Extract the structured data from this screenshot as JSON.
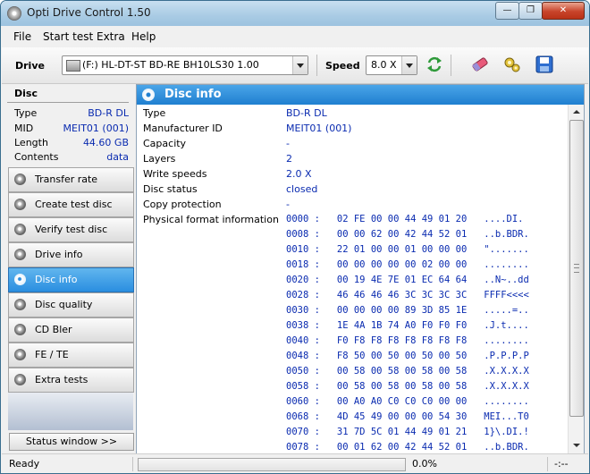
{
  "window": {
    "title": "Opti Drive Control 1.50",
    "minimize_glyph": "—",
    "maximize_glyph": "❐",
    "close_glyph": "✕"
  },
  "menu": [
    "File",
    "Start test",
    "Extra",
    "Help"
  ],
  "toolbar": {
    "drive_label": "Drive",
    "drive_value": "(F:)   HL-DT-ST BD-RE  BH10LS30 1.00",
    "speed_label": "Speed",
    "speed_value": "8.0 X",
    "icons": [
      "refresh-icon",
      "eraser-icon",
      "settings-icon",
      "save-icon"
    ]
  },
  "disc": {
    "heading": "Disc",
    "props": [
      {
        "key": "Type",
        "value": "BD-R DL"
      },
      {
        "key": "MID",
        "value": "MEIT01 (001)"
      },
      {
        "key": "Length",
        "value": "44.60 GB"
      },
      {
        "key": "Contents",
        "value": "data"
      }
    ]
  },
  "nav": [
    {
      "label": "Transfer rate",
      "active": false
    },
    {
      "label": "Create test disc",
      "active": false
    },
    {
      "label": "Verify test disc",
      "active": false
    },
    {
      "label": "Drive info",
      "active": false
    },
    {
      "label": "Disc info",
      "active": true
    },
    {
      "label": "Disc quality",
      "active": false
    },
    {
      "label": "CD Bler",
      "active": false
    },
    {
      "label": "FE / TE",
      "active": false
    },
    {
      "label": "Extra tests",
      "active": false
    }
  ],
  "status_window_label": "Status window >>",
  "main": {
    "title": "Disc info",
    "rows": [
      {
        "key": "Type",
        "value": "BD-R DL"
      },
      {
        "key": "Manufacturer ID",
        "value": "MEIT01 (001)"
      },
      {
        "key": "Capacity",
        "value": "-"
      },
      {
        "key": "Layers",
        "value": "2"
      },
      {
        "key": "Write speeds",
        "value": "2.0 X"
      },
      {
        "key": "Disc status",
        "value": "closed"
      },
      {
        "key": "Copy protection",
        "value": "-"
      },
      {
        "key": "Physical format information",
        "value": ""
      }
    ],
    "hex_lines": [
      "0000 :   02 FE 00 00 44 49 01 20   ....DI.",
      "0008 :   00 00 62 00 42 44 52 01   ..b.BDR.",
      "0010 :   22 01 00 00 01 00 00 00   \".......",
      "0018 :   00 00 00 00 00 02 00 00   ........",
      "0020 :   00 19 4E 7E 01 EC 64 64   ..N~..dd",
      "0028 :   46 46 46 46 3C 3C 3C 3C   FFFF<<<<",
      "0030 :   00 00 00 00 89 3D 85 1E   .....=..",
      "0038 :   1E 4A 1B 74 A0 F0 F0 F0   .J.t....",
      "0040 :   F0 F8 F8 F8 F8 F8 F8 F8   ........",
      "0048 :   F8 50 00 50 00 50 00 50   .P.P.P.P",
      "0050 :   00 58 00 58 00 58 00 58   .X.X.X.X",
      "0058 :   00 58 00 58 00 58 00 58   .X.X.X.X",
      "0060 :   00 A0 A0 C0 C0 C0 00 00   ........",
      "0068 :   4D 45 49 00 00 00 54 30   MEI...T0",
      "0070 :   31 7D 5C 01 44 49 01 21   1}\\.DI.!",
      "0078 :   00 01 62 00 42 44 52 01   ..b.BDR."
    ]
  },
  "status": {
    "ready": "Ready",
    "progress_percent": 0.0,
    "progress_text": "0.0%",
    "time": "-:--"
  },
  "colors": {
    "accent_blue": "#2a8ee0",
    "value_text": "#0a2bb0",
    "progress_fill": "#3bb54a"
  }
}
